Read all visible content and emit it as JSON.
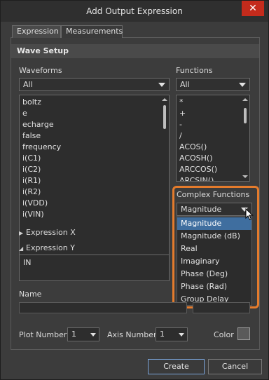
{
  "window": {
    "title": "Add Output Expression",
    "close_glyph": "✕"
  },
  "tabs": [
    {
      "label": "Expression"
    },
    {
      "label": "Measurements"
    }
  ],
  "wave_setup": {
    "header": "Wave Setup",
    "waveforms": {
      "label": "Waveforms",
      "filter": "All",
      "items": [
        "boltz",
        "e",
        "echarge",
        "false",
        "frequency",
        "i(C1)",
        "i(C2)",
        "i(R1)",
        "i(R2)",
        "i(VDD)",
        "i(VIN)"
      ]
    },
    "functions": {
      "label": "Functions",
      "filter": "All",
      "items": [
        "*",
        "+",
        "-",
        "/",
        "ACOS()",
        "ACOSH()",
        "ARCCOS()",
        "ARCSIN()"
      ]
    },
    "complex_functions": {
      "label": "Complex Functions",
      "selected": "Magnitude",
      "options": [
        "Magnitude",
        "Magnitude (dB)",
        "Real",
        "Imaginary",
        "Phase (Deg)",
        "Phase (Rad)",
        "Group Delay"
      ]
    }
  },
  "expression_x": {
    "label": "Expression X"
  },
  "expression_y": {
    "label": "Expression Y",
    "value": "IN"
  },
  "name": {
    "label": "Name"
  },
  "plot": {
    "plot_number_label": "Plot Number",
    "plot_number": "1",
    "axis_number_label": "Axis Number",
    "axis_number": "1",
    "color_label": "Color"
  },
  "buttons": {
    "create": "Create",
    "cancel": "Cancel"
  },
  "colors": {
    "highlight": "#e47b2c",
    "selection": "#3f6e9f",
    "close": "#c42b1c"
  }
}
